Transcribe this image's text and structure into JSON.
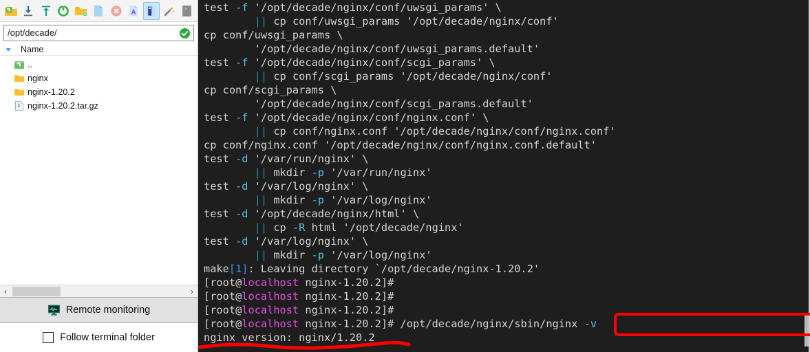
{
  "app": {
    "title": "SFTP file browser with terminal"
  },
  "toolbar": {
    "buttons": [
      {
        "name": "open-parent-folder-icon",
        "label": "Open parent folder"
      },
      {
        "name": "download-icon",
        "label": "Download"
      },
      {
        "name": "upload-icon",
        "label": "Upload"
      },
      {
        "name": "refresh-icon",
        "label": "Refresh"
      },
      {
        "name": "new-folder-icon",
        "label": "New folder"
      },
      {
        "name": "new-file-icon",
        "label": "New file"
      },
      {
        "name": "delete-icon",
        "label": "Delete"
      },
      {
        "name": "rename-icon",
        "label": "Rename"
      },
      {
        "name": "edit-icon",
        "label": "Edit",
        "selected": true
      },
      {
        "name": "magic-wand-icon",
        "label": "Transfer settings"
      },
      {
        "name": "terminal-icon",
        "label": "Open terminal here"
      }
    ]
  },
  "pathbar": {
    "value": "/opt/decade/",
    "placeholder": "/",
    "status_icon": "check-circle-icon"
  },
  "filelist": {
    "column_header": "Name",
    "sort_icon": "sort-descending-caret-icon",
    "rows": [
      {
        "name": "..",
        "icon": "parent-folder-icon"
      },
      {
        "name": "nginx",
        "icon": "folder-icon"
      },
      {
        "name": "nginx-1.20.2",
        "icon": "folder-icon"
      },
      {
        "name": "nginx-1.20.2.tar.gz",
        "icon": "archive-file-icon"
      }
    ]
  },
  "hscrollbar": {
    "left_arrow": "‹",
    "right_arrow": "›"
  },
  "footer": {
    "remote_monitoring_label": "Remote monitoring",
    "remote_monitoring_icon": "monitor-waveform-icon",
    "follow_terminal_folder_label": "Follow terminal folder",
    "follow_terminal_folder_checked": false
  },
  "terminal": {
    "prompt_user": "root",
    "prompt_host": "localhost",
    "prompt_dir": "nginx-1.20.2",
    "lines": [
      "test -f '/opt/decade/nginx/conf/uwsgi_params' \\",
      "        || cp conf/uwsgi_params '/opt/decade/nginx/conf'",
      "cp conf/uwsgi_params \\",
      "        '/opt/decade/nginx/conf/uwsgi_params.default'",
      "test -f '/opt/decade/nginx/conf/scgi_params' \\",
      "        || cp conf/scgi_params '/opt/decade/nginx/conf'",
      "cp conf/scgi_params \\",
      "        '/opt/decade/nginx/conf/scgi_params.default'",
      "test -f '/opt/decade/nginx/conf/nginx.conf' \\",
      "        || cp conf/nginx.conf '/opt/decade/nginx/conf/nginx.conf'",
      "cp conf/nginx.conf '/opt/decade/nginx/conf/nginx.conf.default'",
      "test -d '/var/run/nginx' \\",
      "        || mkdir -p '/var/run/nginx'",
      "test -d '/var/log/nginx' \\",
      "        || mkdir -p '/var/log/nginx'",
      "test -d '/opt/decade/nginx/html' \\",
      "        || cp -R html '/opt/decade/nginx'",
      "test -d '/var/log/nginx' \\",
      "        || mkdir -p '/var/log/nginx'",
      "make[1]: Leaving directory `/opt/decade/nginx-1.20.2'",
      "[root@localhost nginx-1.20.2]#",
      "[root@localhost nginx-1.20.2]#",
      "[root@localhost nginx-1.20.2]#",
      "[root@localhost nginx-1.20.2]# /opt/decade/nginx/sbin/nginx -v",
      "nginx version: nginx/1.20.2"
    ],
    "entered_command": "/opt/decade/nginx/sbin/nginx -v",
    "command_output": "nginx version: nginx/1.20.2"
  },
  "annotations": {
    "highlight_box_target": "/opt/decade/nginx/sbin/nginx -v",
    "underline_target": "nginx version: nginx/1.20.2",
    "color": "#fd0000"
  },
  "colors": {
    "terminal_background": "#1e1e1e",
    "terminal_foreground": "#d4d4d4",
    "flag_color": "#4fc1e9",
    "operator_color": "#1f8fa8",
    "host_color": "#e44ee4",
    "bracket_color": "#3b8eea",
    "annotation_red": "#fd0000",
    "selected_toolbar_button": "#cfe6fa"
  }
}
